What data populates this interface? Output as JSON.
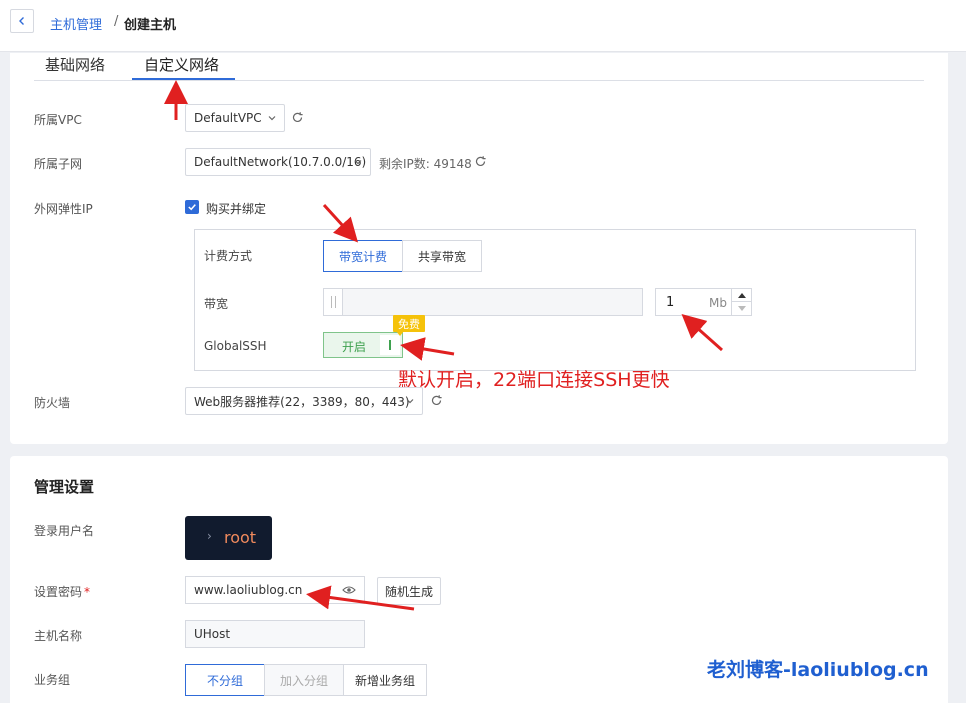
{
  "breadcrumb": {
    "parent": "主机管理",
    "separator": "/",
    "current": "创建主机"
  },
  "network": {
    "tabs": [
      {
        "label": "基础网络",
        "active": false
      },
      {
        "label": "自定义网络",
        "active": true
      }
    ],
    "vpc": {
      "label": "所属VPC",
      "value": "DefaultVPC"
    },
    "subnet": {
      "label": "所属子网",
      "value": "DefaultNetwork(10.7.0.0/16)",
      "remaining_ip": "剩余IP数: 49148"
    },
    "eip": {
      "label": "外网弹性IP",
      "checkbox_label": "购买并绑定",
      "checked": true,
      "billing": {
        "label": "计费方式",
        "options": [
          "带宽计费",
          "共享带宽"
        ],
        "selected": "带宽计费"
      },
      "bandwidth": {
        "label": "带宽",
        "value": "1",
        "unit": "Mb"
      },
      "global_ssh": {
        "label": "GlobalSSH",
        "state_text": "开启",
        "badge": "免费"
      }
    },
    "firewall": {
      "label": "防火墙",
      "value": "Web服务器推荐(22，3389，80，443)"
    }
  },
  "management": {
    "title": "管理设置",
    "login_user": {
      "label": "登录用户名",
      "value": "root"
    },
    "password": {
      "label": "设置密码",
      "required_mark": "*",
      "value": "www.laoliublog.cn",
      "random_button": "随机生成"
    },
    "hostname": {
      "label": "主机名称",
      "value": "UHost"
    },
    "business_group": {
      "label": "业务组",
      "options": [
        "不分组",
        "加入分组",
        "新增业务组"
      ],
      "selected": "不分组"
    }
  },
  "annotation": {
    "text": "默认开启，22端口连接SSH更快",
    "color": "#e02020"
  },
  "watermark": "老刘博客-laoliublog.cn",
  "colors": {
    "accent": "#2f6bd8",
    "success": "#3fa14f",
    "badge": "#f5c20a"
  }
}
